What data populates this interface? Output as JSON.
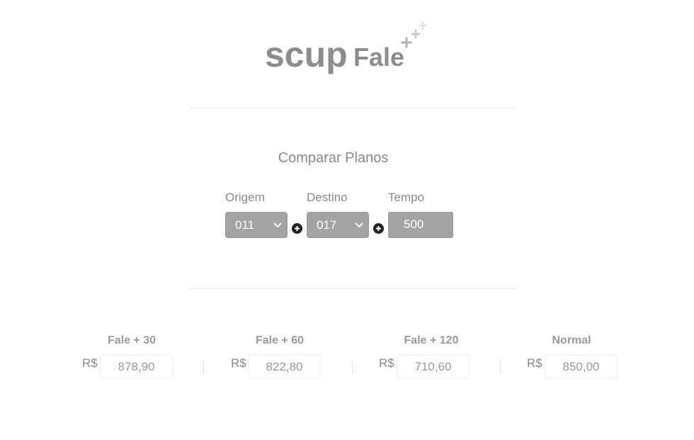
{
  "logo": {
    "scup": "scup",
    "fale": "Fale",
    "plus_color": "#b0b0b0",
    "plus_faint_color": "#d8d8d8"
  },
  "compare": {
    "title": "Comparar Planos",
    "origem": {
      "label": "Origem",
      "value": "011"
    },
    "destino": {
      "label": "Destino",
      "value": "017"
    },
    "tempo": {
      "label": "Tempo",
      "value": "500"
    }
  },
  "plans": [
    {
      "name": "Fale + 30",
      "currency": "R$",
      "price": "878,90"
    },
    {
      "name": "Fale + 60",
      "currency": "R$",
      "price": "822,80"
    },
    {
      "name": "Fale + 120",
      "currency": "R$",
      "price": "710,60"
    },
    {
      "name": "Normal",
      "currency": "R$",
      "price": "850,00"
    }
  ],
  "icons": {
    "select_arrow": "chevron-down-icon",
    "add": "plus-circle-icon",
    "logo_sparkle": "plus-icon"
  }
}
